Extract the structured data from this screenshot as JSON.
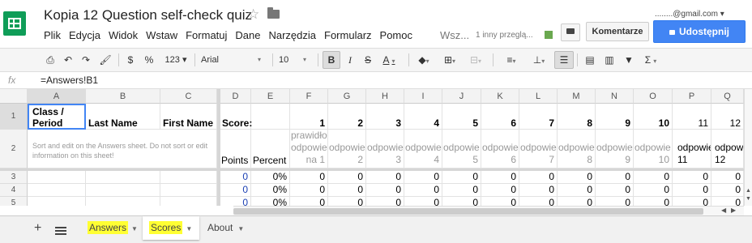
{
  "app": {
    "doc_title": "Kopia 12 Question self-check quiz",
    "email": "........@gmail.com",
    "menu": [
      "Plik",
      "Edycja",
      "Widok",
      "Wstaw",
      "Formatuj",
      "Dane",
      "Narzędzia",
      "Formularz",
      "Pomoc"
    ],
    "menu_more": "Wsz...",
    "viewers_text": "1 inny przeglą...",
    "comments_button": "Komentarze",
    "share_button": "Udostępnij",
    "brand_color": "#0f9d58",
    "share_color": "#4285f4"
  },
  "toolbar": {
    "currency": "$",
    "percent": "%",
    "number_format": "123 ▾",
    "font": "Arial",
    "font_size": "10",
    "bold": "B",
    "italic": "I",
    "strike": "S",
    "text_color": "A"
  },
  "formula": {
    "fx": "fx",
    "value": "=Answers!B1"
  },
  "columns": [
    "A",
    "B",
    "C",
    "D",
    "E",
    "F",
    "G",
    "H",
    "I",
    "J",
    "K",
    "L",
    "M",
    "N",
    "O",
    "P",
    "Q"
  ],
  "rows": [
    "1",
    "2",
    "3",
    "4",
    "5"
  ],
  "row1": {
    "a": [
      "Class /",
      "Period"
    ],
    "b": "Last Name",
    "c": "First Name",
    "d": "Score:",
    "nums": [
      "1",
      "2",
      "3",
      "4",
      "5",
      "6",
      "7",
      "8",
      "9",
      "10",
      "11",
      "12"
    ]
  },
  "row2": {
    "note": "Sort and edit on the Answers sheet. Do not sort or edit information on this sheet!",
    "d": "Points",
    "e": "Percent",
    "f_top": "prawidło",
    "f_mid": "odpowie",
    "f_bot": "na 1",
    "mid_label": "odpowie",
    "sub_nums": [
      "2",
      "3",
      "4",
      "5",
      "6",
      "7",
      "8",
      "9",
      "10"
    ],
    "p_top": "odpowie",
    "p_bot": "11",
    "q_top": "odpow",
    "q_bot": "12"
  },
  "data_rows": [
    {
      "points": "0",
      "percent": "0%",
      "vals": [
        "0",
        "0",
        "0",
        "0",
        "0",
        "0",
        "0",
        "0",
        "0",
        "0",
        "0",
        "0"
      ]
    },
    {
      "points": "0",
      "percent": "0%",
      "vals": [
        "0",
        "0",
        "0",
        "0",
        "0",
        "0",
        "0",
        "0",
        "0",
        "0",
        "0",
        "0"
      ]
    },
    {
      "points": "0",
      "percent": "0%",
      "vals": [
        "0",
        "0",
        "0",
        "0",
        "0",
        "0",
        "0",
        "0",
        "0",
        "0",
        "0",
        "0"
      ]
    }
  ],
  "sheets": [
    {
      "name": "Answers",
      "highlighted": true
    },
    {
      "name": "Scores",
      "highlighted": true,
      "active": true
    },
    {
      "name": "About",
      "highlighted": false
    }
  ]
}
